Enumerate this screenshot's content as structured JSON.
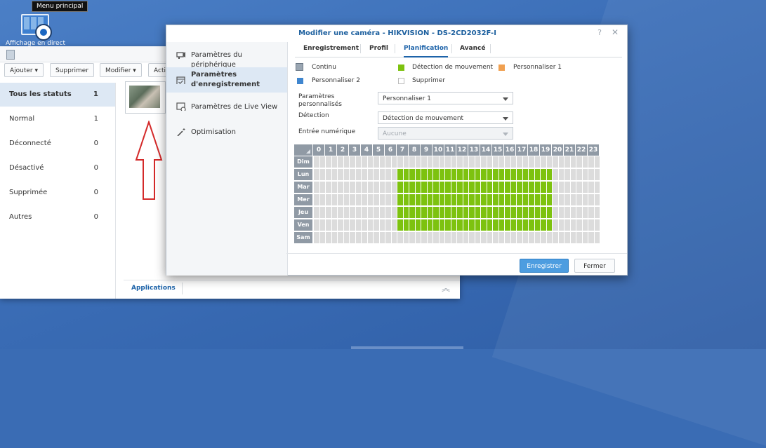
{
  "desktop": {
    "tooltip": "Menu principal",
    "icon_label": "Affichage en direct",
    "icon_name": "live-view-camera-icon"
  },
  "background_window": {
    "toolbar": {
      "add": "Ajouter ▾",
      "delete": "Supprimer",
      "modify": "Modifier ▾",
      "action": "Acti"
    },
    "statuses": [
      {
        "label": "Tous les statuts",
        "count": "1"
      },
      {
        "label": "Normal",
        "count": "1"
      },
      {
        "label": "Déconnecté",
        "count": "0"
      },
      {
        "label": "Désactivé",
        "count": "0"
      },
      {
        "label": "Supprimée",
        "count": "0"
      },
      {
        "label": "Autres",
        "count": "0"
      }
    ],
    "applications_tab": "Applications"
  },
  "dialog": {
    "title": "Modifier une caméra - HIKVISION - DS-2CD2032F-I",
    "help": "?",
    "close": "✕",
    "nav": [
      {
        "label": "Paramètres du périphérique",
        "icon": "device-camera-icon"
      },
      {
        "label": "Paramètres d'enregistrement",
        "icon": "calendar-check-icon"
      },
      {
        "label": "Paramètres de Live View",
        "icon": "live-view-icon"
      },
      {
        "label": "Optimisation",
        "icon": "magic-wand-icon"
      }
    ],
    "tabs": [
      "Enregistrement",
      "Profil",
      "Planification",
      "Avancé"
    ],
    "selected_tab": "Planification",
    "legend": {
      "continuous": "Continu",
      "motion": "Détection de mouvement",
      "custom1": "Personnaliser 1",
      "custom2": "Personnaliser 2",
      "delete": "Supprimer"
    },
    "colors": {
      "continuous": "#8a98a6",
      "motion": "#7dc20f",
      "custom1": "#f0a050",
      "custom2": "#3f86cf",
      "off": "#dcdcdc",
      "accent": "#1d63a9"
    },
    "form": {
      "custom_params_label": "Paramètres personnalisés",
      "custom_params_value": "Personnaliser 1",
      "detection_label": "Détection",
      "detection_value": "Détection de mouvement",
      "digital_input_label": "Entrée numérique",
      "digital_input_value": "Aucune"
    },
    "schedule": {
      "hours": [
        "0",
        "1",
        "2",
        "3",
        "4",
        "5",
        "6",
        "7",
        "8",
        "9",
        "10",
        "11",
        "12",
        "13",
        "14",
        "15",
        "16",
        "17",
        "18",
        "19",
        "20",
        "21",
        "22",
        "23"
      ],
      "days": [
        "Dim",
        "Lun",
        "Mar",
        "Mer",
        "Jeu",
        "Ven",
        "Sam"
      ],
      "active_days": [
        "Lun",
        "Mar",
        "Mer",
        "Jeu",
        "Ven"
      ],
      "active_from_hour": 7,
      "active_to_hour": 19,
      "active_mode": "Détection de mouvement"
    },
    "buttons": {
      "save": "Enregistrer",
      "close": "Fermer"
    }
  }
}
